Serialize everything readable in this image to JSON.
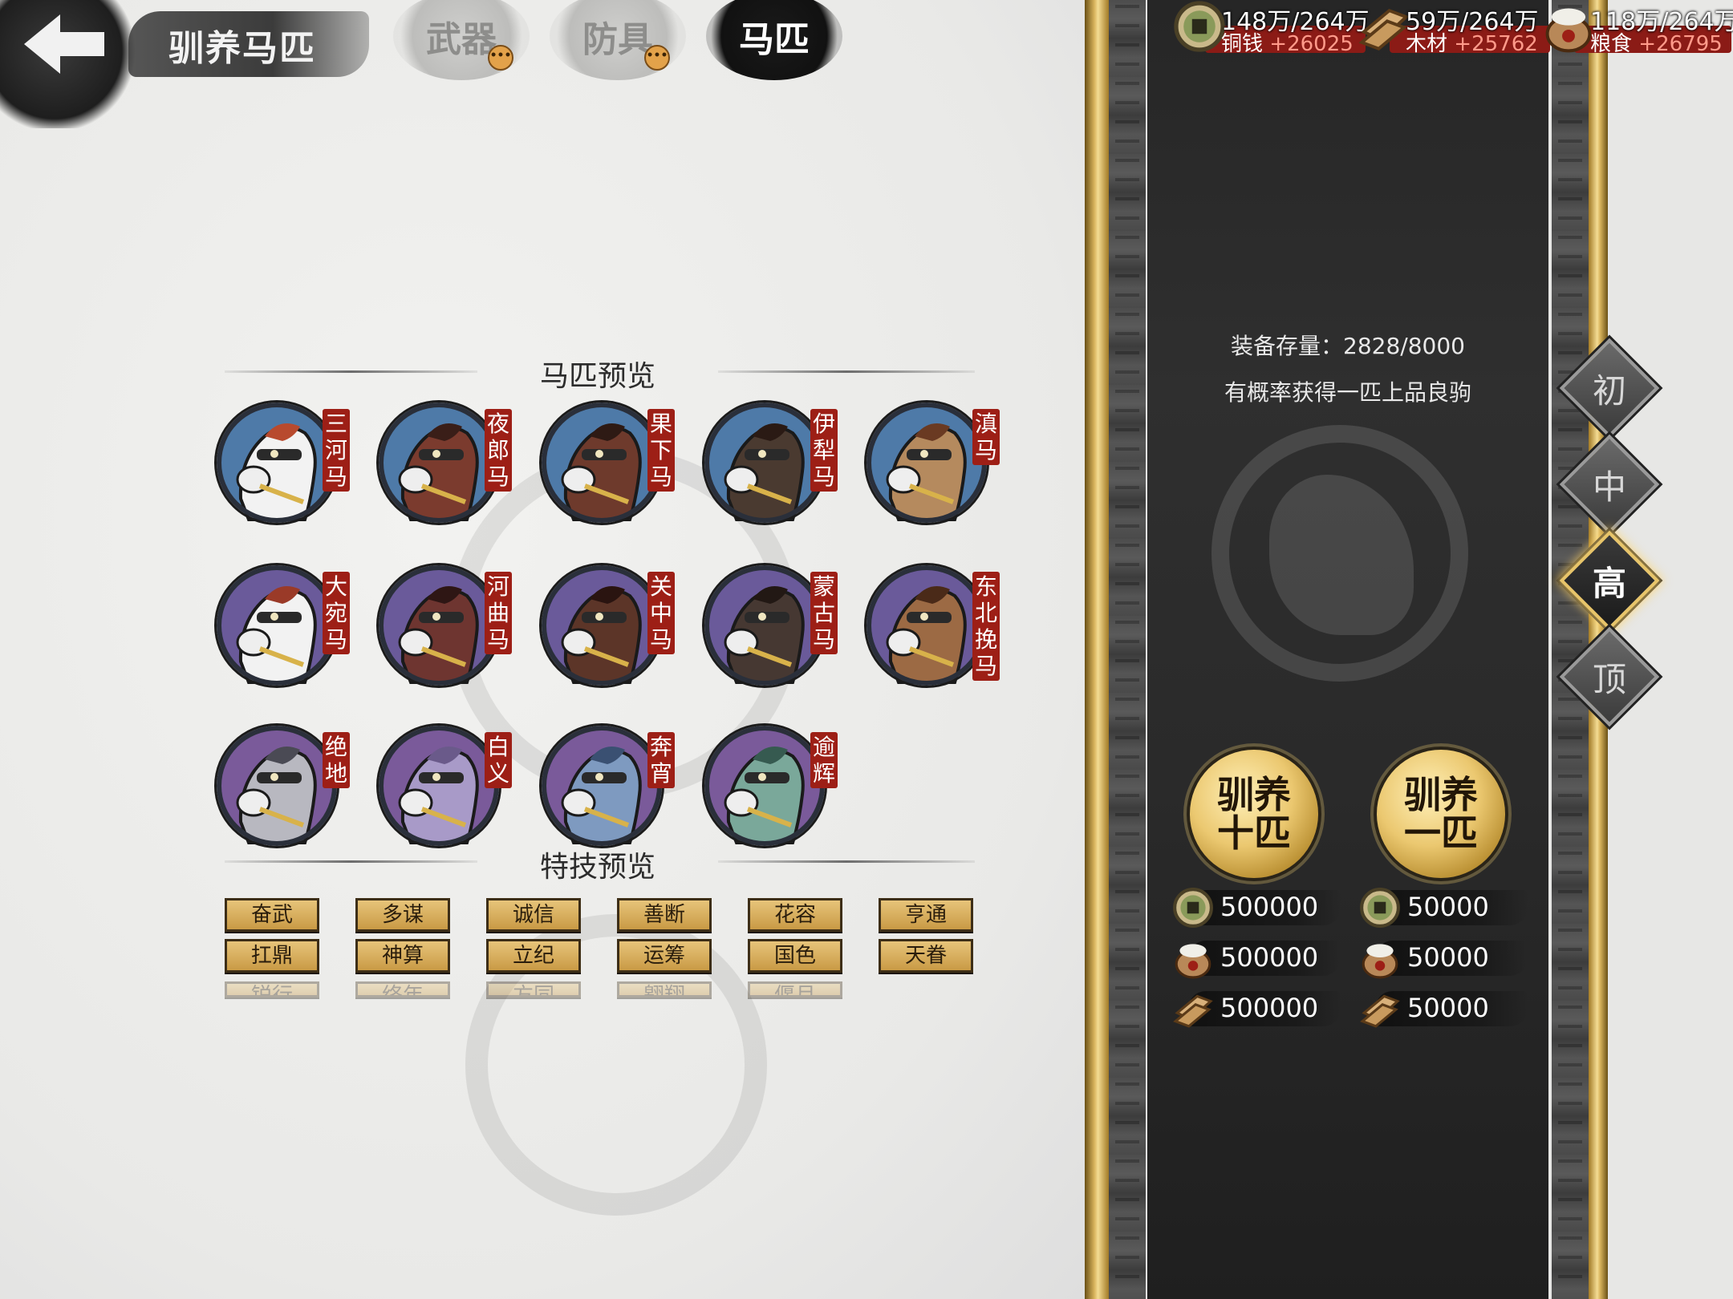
{
  "header": {
    "title": "驯养马匹",
    "tabs": [
      {
        "label": "武器",
        "badge": "•••"
      },
      {
        "label": "防具",
        "badge": "•••"
      },
      {
        "label": "马匹"
      }
    ]
  },
  "resources": [
    {
      "name": "铜钱",
      "amount": "148万/264万",
      "rate": "+26025",
      "icon": "coin-icon"
    },
    {
      "name": "木材",
      "amount": "59万/264万",
      "rate": "+25762",
      "icon": "wood-icon"
    },
    {
      "name": "粮食",
      "amount": "118万/264万",
      "rate": "+26795",
      "icon": "grain-icon"
    }
  ],
  "preview": {
    "horse_title": "马匹预览",
    "horses": [
      {
        "name": "三河马",
        "body": "#f2f2f2",
        "mane": "#b84a2e",
        "ring": "#4e7aa8"
      },
      {
        "name": "夜郎马",
        "body": "#7b3b2e",
        "mane": "#3a1e18",
        "ring": "#4e7aa8"
      },
      {
        "name": "果下马",
        "body": "#6e3a2c",
        "mane": "#2e1a14",
        "ring": "#4e7aa8"
      },
      {
        "name": "伊犁马",
        "body": "#4a3a30",
        "mane": "#2a1a14",
        "ring": "#4e7aa8"
      },
      {
        "name": "滇马",
        "body": "#b58a5e",
        "mane": "#6a3a22",
        "ring": "#4e7aa8"
      },
      {
        "name": "大宛马",
        "body": "#f2f2f2",
        "mane": "#9a3a28",
        "ring": "#6a5a9a"
      },
      {
        "name": "河曲马",
        "body": "#6e3530",
        "mane": "#2e1614",
        "ring": "#6a5a9a"
      },
      {
        "name": "关中马",
        "body": "#5c3528",
        "mane": "#2a1410",
        "ring": "#6a5a9a"
      },
      {
        "name": "蒙古马",
        "body": "#463832",
        "mane": "#221814",
        "ring": "#6a5a9a"
      },
      {
        "name": "东北挽马",
        "body": "#9c6a44",
        "mane": "#4a2a18",
        "ring": "#6a5a9a"
      },
      {
        "name": "绝地",
        "body": "#b8b8c0",
        "mane": "#4a4a54",
        "ring": "#7a5a9a"
      },
      {
        "name": "白义",
        "body": "#a89ac8",
        "mane": "#6a5a8a",
        "ring": "#7a5a9a"
      },
      {
        "name": "奔宵",
        "body": "#7e9ac0",
        "mane": "#3a5072",
        "ring": "#7a5a9a"
      },
      {
        "name": "逾辉",
        "body": "#7aa89a",
        "mane": "#365a50",
        "ring": "#7a5a9a"
      }
    ],
    "skill_title": "特技预览",
    "skills": [
      "奋武",
      "多谋",
      "诚信",
      "善断",
      "花容",
      "亨通",
      "扛鼎",
      "神算",
      "立纪",
      "运筹",
      "国色",
      "天眷"
    ],
    "skills_partial": [
      "锐行",
      "络年",
      "方同",
      "翱翔",
      "偃月"
    ]
  },
  "panel": {
    "storage_label": "装备存量：2828/8000",
    "hint": "有概率获得一匹上品良驹",
    "tiers": [
      {
        "label": "初",
        "active": false
      },
      {
        "label": "中",
        "active": false
      },
      {
        "label": "高",
        "active": true
      },
      {
        "label": "顶",
        "active": false
      }
    ],
    "buttons": [
      {
        "label": "驯养十匹",
        "costs": [
          {
            "icon": "coin-icon",
            "value": "500000"
          },
          {
            "icon": "grain-icon",
            "value": "500000"
          },
          {
            "icon": "wood-icon",
            "value": "500000"
          }
        ]
      },
      {
        "label": "驯养一匹",
        "costs": [
          {
            "icon": "coin-icon",
            "value": "50000"
          },
          {
            "icon": "grain-icon",
            "value": "50000"
          },
          {
            "icon": "wood-icon",
            "value": "50000"
          }
        ]
      }
    ]
  },
  "colors": {
    "accent_gold": "#e8c56a",
    "label_red": "#9d1f16",
    "resource_bar": "#8b1b16"
  }
}
